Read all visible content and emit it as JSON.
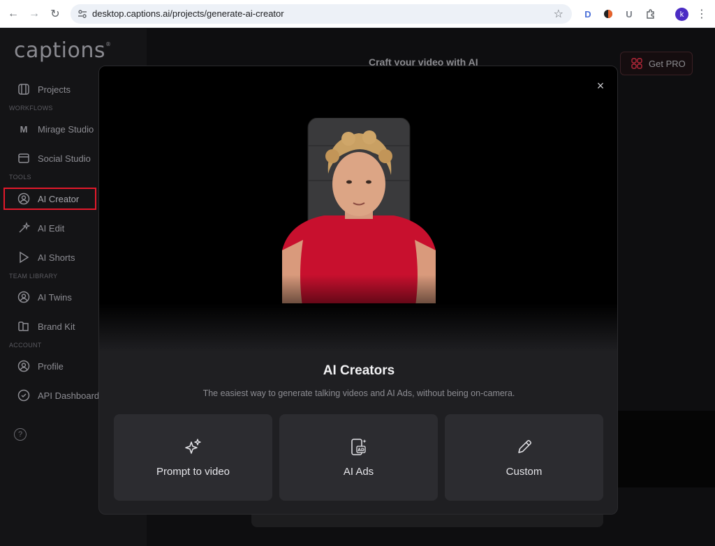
{
  "browser": {
    "url": "desktop.captions.ai/projects/generate-ai-creator",
    "extensions": [
      "D",
      "U"
    ],
    "profile_initial": "k"
  },
  "sidebar": {
    "logo": "captions",
    "items": [
      {
        "label": "Projects",
        "icon": "projects-icon"
      },
      {
        "label": "Mirage Studio",
        "icon": "mirage-icon"
      },
      {
        "label": "Social Studio",
        "icon": "social-studio-icon"
      },
      {
        "label": "AI Creator",
        "icon": "ai-creator-icon"
      },
      {
        "label": "AI Edit",
        "icon": "sparkle-icon"
      },
      {
        "label": "AI Shorts",
        "icon": "play-icon"
      },
      {
        "label": "AI Twins",
        "icon": "ai-twins-icon"
      },
      {
        "label": "Brand Kit",
        "icon": "brand-kit-icon"
      },
      {
        "label": "Profile",
        "icon": "profile-icon"
      },
      {
        "label": "API Dashboard",
        "icon": "api-icon"
      }
    ],
    "sections": [
      "WORKFLOWS",
      "TOOLS",
      "TEAM LIBRARY",
      "ACCOUNT"
    ],
    "help": "?"
  },
  "main": {
    "title": "Craft your video with AI",
    "get_pro": "Get PRO"
  },
  "modal": {
    "title": "AI Creators",
    "subtitle": "The easiest way to generate talking videos and AI Ads, without being on-camera.",
    "close": "×",
    "options": [
      {
        "label": "Prompt to video",
        "icon": "sparkles-icon"
      },
      {
        "label": "AI Ads",
        "icon": "ad-icon"
      },
      {
        "label": "Custom",
        "icon": "pencil-icon"
      }
    ]
  },
  "colors": {
    "accent": "#e4192b",
    "modal_bg": "#1f1f22",
    "card_bg": "#2c2c30"
  }
}
